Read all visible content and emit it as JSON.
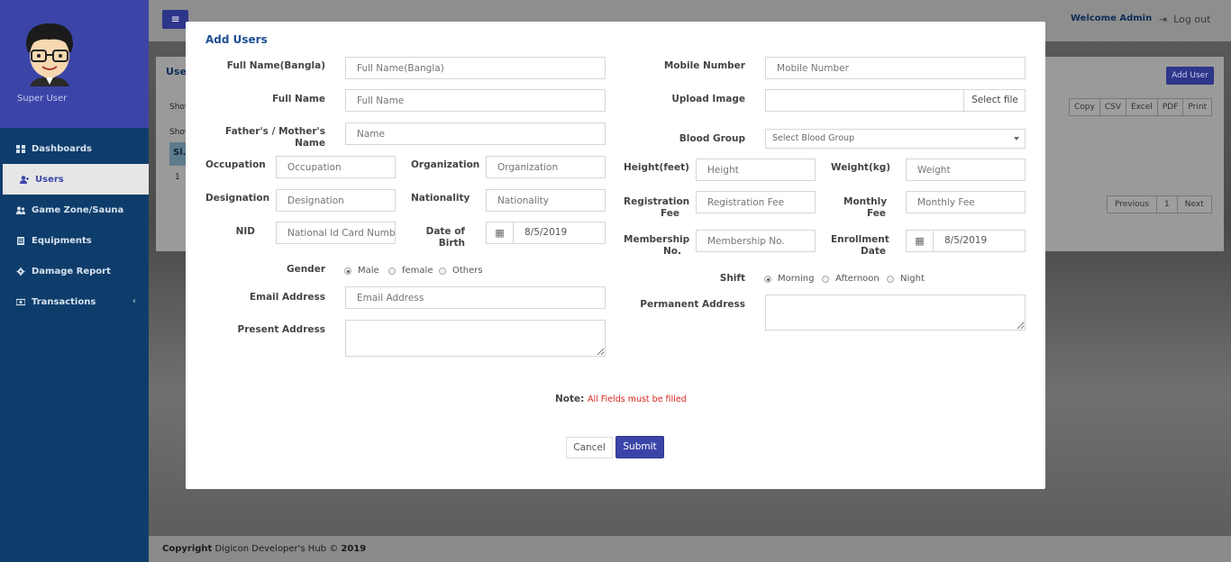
{
  "sidebar": {
    "profile_name": "Super User",
    "items": [
      {
        "label": "Dashboards",
        "icon": "dashboard-icon"
      },
      {
        "label": "Users",
        "icon": "add-user-icon"
      },
      {
        "label": "Game Zone/Sauna",
        "icon": "users-icon"
      },
      {
        "label": "Equipments",
        "icon": "list-icon"
      },
      {
        "label": "Damage Report",
        "icon": "gear-icon"
      },
      {
        "label": "Transactions",
        "icon": "money-icon"
      }
    ]
  },
  "topbar": {
    "welcome": "Welcome Admin",
    "logout": "Log out"
  },
  "background": {
    "panel_title": "User",
    "add_user": "Add User",
    "show1": "Show",
    "show2": "Show",
    "col_sl": "Sl.",
    "row_one": "1",
    "export_buttons": [
      "Copy",
      "CSV",
      "Excel",
      "PDF",
      "Print"
    ],
    "pager": {
      "previous": "Previous",
      "page": "1",
      "next": "Next"
    }
  },
  "modal": {
    "title": "Add Users",
    "fields": {
      "full_name_bangla": {
        "label": "Full Name(Bangla)",
        "placeholder": "Full Name(Bangla)"
      },
      "full_name": {
        "label": "Full Name",
        "placeholder": "Full Name"
      },
      "parent_name": {
        "label": "Father's / Mother's Name",
        "placeholder": "Name"
      },
      "occupation": {
        "label": "Occupation",
        "placeholder": "Occupation"
      },
      "organization": {
        "label": "Organization",
        "placeholder": "Organization"
      },
      "designation": {
        "label": "Designation",
        "placeholder": "Designation"
      },
      "nationality": {
        "label": "Nationality",
        "placeholder": "Nationality"
      },
      "nid": {
        "label": "NID",
        "placeholder": "National Id Card Number"
      },
      "dob": {
        "label": "Date of Birth",
        "value": "8/5/2019"
      },
      "gender": {
        "label": "Gender",
        "options": [
          "Male",
          "female",
          "Others"
        ],
        "selected": "Male"
      },
      "email": {
        "label": "Email Address",
        "placeholder": "Email Address"
      },
      "present_address": {
        "label": "Present Address"
      },
      "mobile": {
        "label": "Mobile Number",
        "placeholder": "Mobile Number"
      },
      "upload_image": {
        "label": "Upload Image",
        "button": "Select file"
      },
      "blood_group": {
        "label": "Blood Group",
        "placeholder": "Select Blood Group"
      },
      "height": {
        "label": "Height(feet)",
        "placeholder": "Height"
      },
      "weight": {
        "label": "Weight(kg)",
        "placeholder": "Weight"
      },
      "registration_fee": {
        "label": "Registration Fee",
        "placeholder": "Registration Fee"
      },
      "monthly_fee": {
        "label": "Monthly Fee",
        "placeholder": "Monthly Fee"
      },
      "membership": {
        "label": "Membership No.",
        "placeholder": "Membership No."
      },
      "enrollment_date": {
        "label": "Enrollment Date",
        "value": "8/5/2019"
      },
      "shift": {
        "label": "Shift",
        "options": [
          "Morning",
          "Afternoon",
          "Night"
        ],
        "selected": "Morning"
      },
      "permanent_address": {
        "label": "Permanent Address"
      }
    },
    "note_label": "Note:",
    "note_text": "All Fields must be filled",
    "cancel": "Cancel",
    "submit": "Submit"
  },
  "footer": {
    "copyright": "Copyright",
    "company": "Digicon Developer's Hub ©",
    "year": "2019"
  }
}
